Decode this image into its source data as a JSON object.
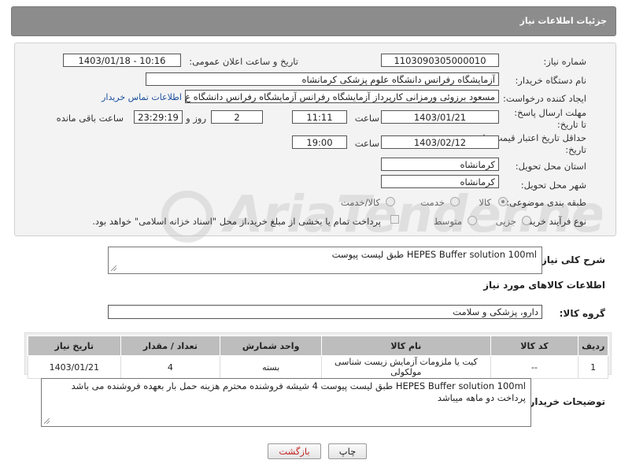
{
  "header": {
    "title": "جزئیات اطلاعات نیاز"
  },
  "form": {
    "need_number_label": "شماره نیاز:",
    "need_number": "1103090305000010",
    "announce_label": "تاریخ و ساعت اعلان عمومی:",
    "announce_value": "1403/01/18 - 10:16",
    "buyer_org_label": "نام دستگاه خریدار:",
    "buyer_org": "آزمایشگاه رفرانس دانشگاه علوم پزشکی کرمانشاه",
    "creator_label": "ایجاد کننده درخواست:",
    "creator": "مسعود برزوئی ورمزانی کارپرداز آزمایشگاه رفرانس آزمایشگاه رفرانس دانشگاه ع",
    "contact_link": "اطلاعات تماس خریدار",
    "deadline_label": "مهلت ارسال پاسخ: تا تاریخ:",
    "deadline_date": "1403/01/21",
    "time_label": "ساعت",
    "deadline_time": "11:11",
    "days": "2",
    "days_label": "روز و",
    "remaining": "23:29:19",
    "remaining_label": "ساعت باقی مانده",
    "validity_label": "حداقل تاریخ اعتبار قیمت: تا تاریخ:",
    "validity_date": "1403/02/12",
    "validity_time": "19:00",
    "province_label": "استان محل تحویل:",
    "province": "کرمانشاه",
    "city_label": "شهر محل تحویل:",
    "city": "کرمانشاه",
    "category_label": "طبقه بندی موضوعی:",
    "category_options": [
      "کالا",
      "خدمت",
      "کالا/خدمت"
    ],
    "process_label": "نوع فرآیند خرید :",
    "process_options": [
      "جزیی",
      "متوسط"
    ],
    "payment_note": "پرداخت تمام یا بخشی از مبلغ خرید،از محل \"اسناد خزانه اسلامی\" خواهد بود."
  },
  "watermark": {
    "text": "AriaTender.neT"
  },
  "summary": {
    "label": "شرح کلی نیاز:",
    "text": "HEPES Buffer solution 100ml طبق لیست پیوست"
  },
  "goods_info_title": "اطلاعات کالاهای مورد نیاز",
  "goods_group": {
    "label": "گروه کالا:",
    "value": "دارو، پزشکی و سلامت"
  },
  "table": {
    "headers": [
      "ردیف",
      "کد کالا",
      "نام کالا",
      "واحد شمارش",
      "تعداد / مقدار",
      "تاریخ نیاز"
    ],
    "rows": [
      [
        "1",
        "--",
        "کیت یا ملزومات آزمایش زیست شناسی مولکولی",
        "بسته",
        "4",
        "1403/01/21"
      ]
    ]
  },
  "buyer_notes": {
    "label": "توضیحات خریدار:",
    "line1": "HEPES Buffer solution 100ml طبق لیست پیوست 4 شیشه فروشنده محترم هزینه حمل بار بعهده فروشنده می باشد",
    "line2": "پرداخت دو ماهه میباشد"
  },
  "buttons": {
    "print": "چاپ",
    "back": "بازگشت"
  }
}
